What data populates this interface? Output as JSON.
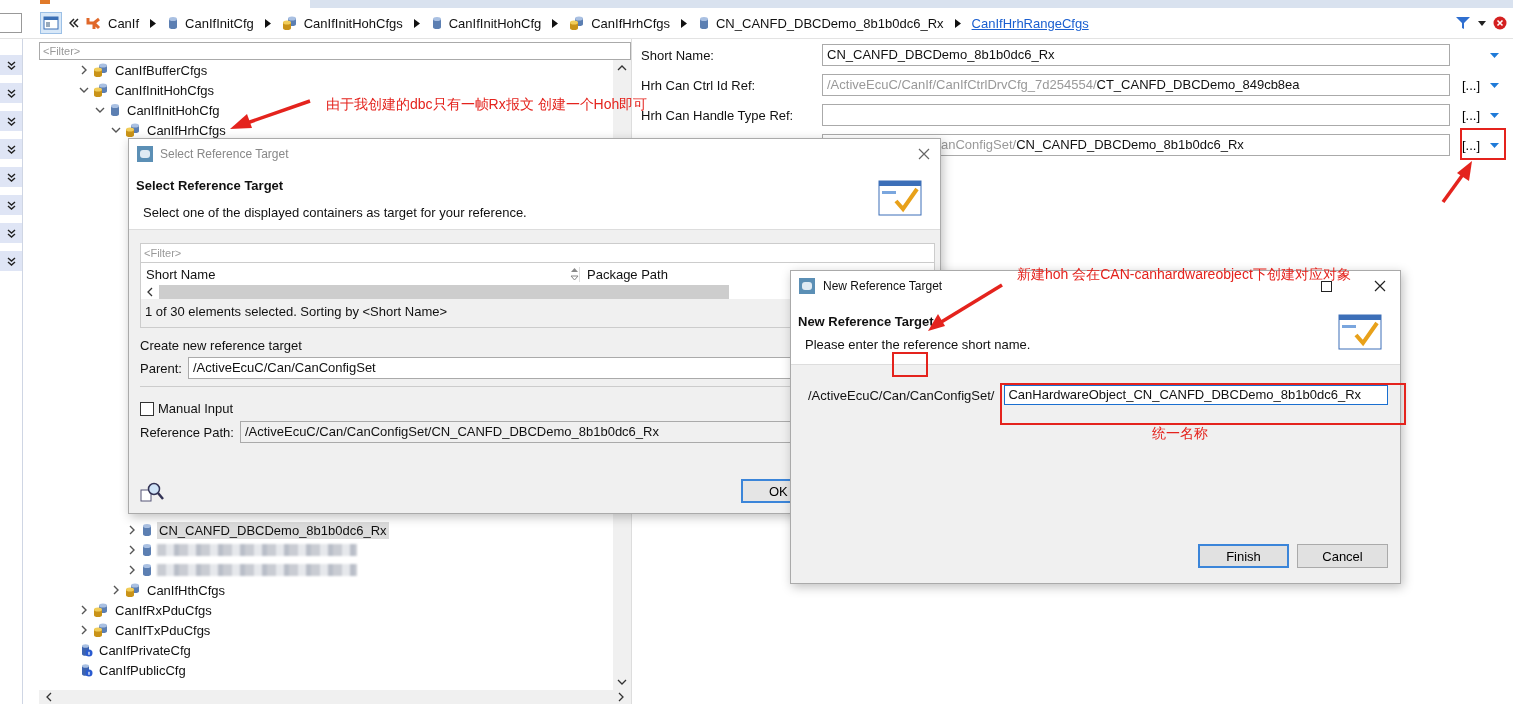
{
  "breadcrumb": [
    {
      "label": "CanIf",
      "kind": "module",
      "link": false
    },
    {
      "label": "CanIfInitCfg",
      "kind": "container",
      "link": false
    },
    {
      "label": "CanIfInitHohCfgs",
      "kind": "containers",
      "link": false
    },
    {
      "label": "CanIfInitHohCfg",
      "kind": "container",
      "link": false
    },
    {
      "label": "CanIfHrhCfgs",
      "kind": "containers",
      "link": false
    },
    {
      "label": "CN_CANFD_DBCDemo_8b1b0dc6_Rx",
      "kind": "container",
      "link": false
    },
    {
      "label": "CanIfHrhRangeCfgs",
      "kind": "plain",
      "link": true
    }
  ],
  "tree": {
    "filter_placeholder": "<Filter>",
    "items": [
      {
        "label": "CanIfBufferCfgs",
        "kind": "containers",
        "expanded": false,
        "selected": false
      },
      {
        "label": "CanIfInitHohCfgs",
        "kind": "containers",
        "expanded": true,
        "selected": false,
        "children": [
          {
            "label": "CanIfInitHohCfg",
            "kind": "container",
            "expanded": true,
            "selected": false,
            "children": [
              {
                "label": "CanIfHrhCfgs",
                "kind": "containers",
                "expanded": true,
                "selected": false,
                "children": [
                  {
                    "label": "CN_CANFD_DBCDemo_8b1b0dc6_Rx",
                    "kind": "container",
                    "expanded": false,
                    "selected": true
                  },
                  {
                    "kind": "blurred",
                    "expanded": false,
                    "selected": false
                  },
                  {
                    "kind": "blurred",
                    "expanded": false,
                    "selected": false
                  }
                ]
              },
              {
                "label": "CanIfHthCfgs",
                "kind": "containers",
                "expanded": false,
                "selected": false
              }
            ]
          }
        ]
      },
      {
        "label": "CanIfRxPduCfgs",
        "kind": "containers",
        "expanded": false,
        "selected": false
      },
      {
        "label": "CanIfTxPduCfgs",
        "kind": "containers",
        "expanded": false,
        "selected": false
      },
      {
        "label": "CanIfPrivateCfg",
        "kind": "param",
        "selected": false
      },
      {
        "label": "CanIfPublicCfg",
        "kind": "param",
        "selected": false
      }
    ]
  },
  "form": [
    {
      "label": "Short Name:",
      "value": "CN_CANFD_DBCDemo_8b1b0dc6_Rx"
    },
    {
      "label": "Hrh Can Ctrl Id Ref:",
      "path": "/ActiveEcuC/CanIf/CanIfCtrlDrvCfg_7d254554/",
      "value": "CT_CANFD_DBCDemo_849cb8ea",
      "browse": "[...]"
    },
    {
      "label": "Hrh Can Handle Type Ref:",
      "browse": "[...]"
    },
    {
      "path": "anConfigSet/",
      "value": "CN_CANFD_DBCDemo_8b1b0dc6_Rx",
      "browse": "[...]"
    }
  ],
  "select_dialog": {
    "title": "Select Reference Target",
    "heading": "Select Reference Target",
    "description": "Select one of the displayed containers as target for your reference.",
    "filter_placeholder": "<Filter>",
    "columns": [
      "Short Name",
      "Package Path"
    ],
    "status": "1 of 30 elements selected. Sorting by <Short Name>",
    "create_label": "Create new reference target",
    "parent_label": "Parent:",
    "parent_value": "/ActiveEcuC/Can/CanConfigSet",
    "manual_input": {
      "label": "Manual Input",
      "checked": false
    },
    "reference_label": "Reference Path:",
    "reference_value": "/ActiveEcuC/Can/CanConfigSet/CN_CANFD_DBCDemo_8b1b0dc6_Rx",
    "ok": "OK"
  },
  "new_dialog": {
    "title": "New Reference Target",
    "heading": "New Reference Target",
    "description": "Please enter the reference short name.",
    "prefix": "/ActiveEcuC/Can/CanConfigSet/",
    "value": "CanHardwareObject_CN_CANFD_DBCDemo_8b1b0dc6_Rx",
    "buttons": [
      {
        "label": "Finish",
        "default": true
      },
      {
        "label": "Cancel",
        "default": false
      }
    ]
  },
  "notes": [
    "由于我创建的dbc只有一帧Rx报文 创建一个Hoh即可",
    "新建hoh 会在CAN-canhardwareobject下创建对应对象",
    "统一名称"
  ]
}
